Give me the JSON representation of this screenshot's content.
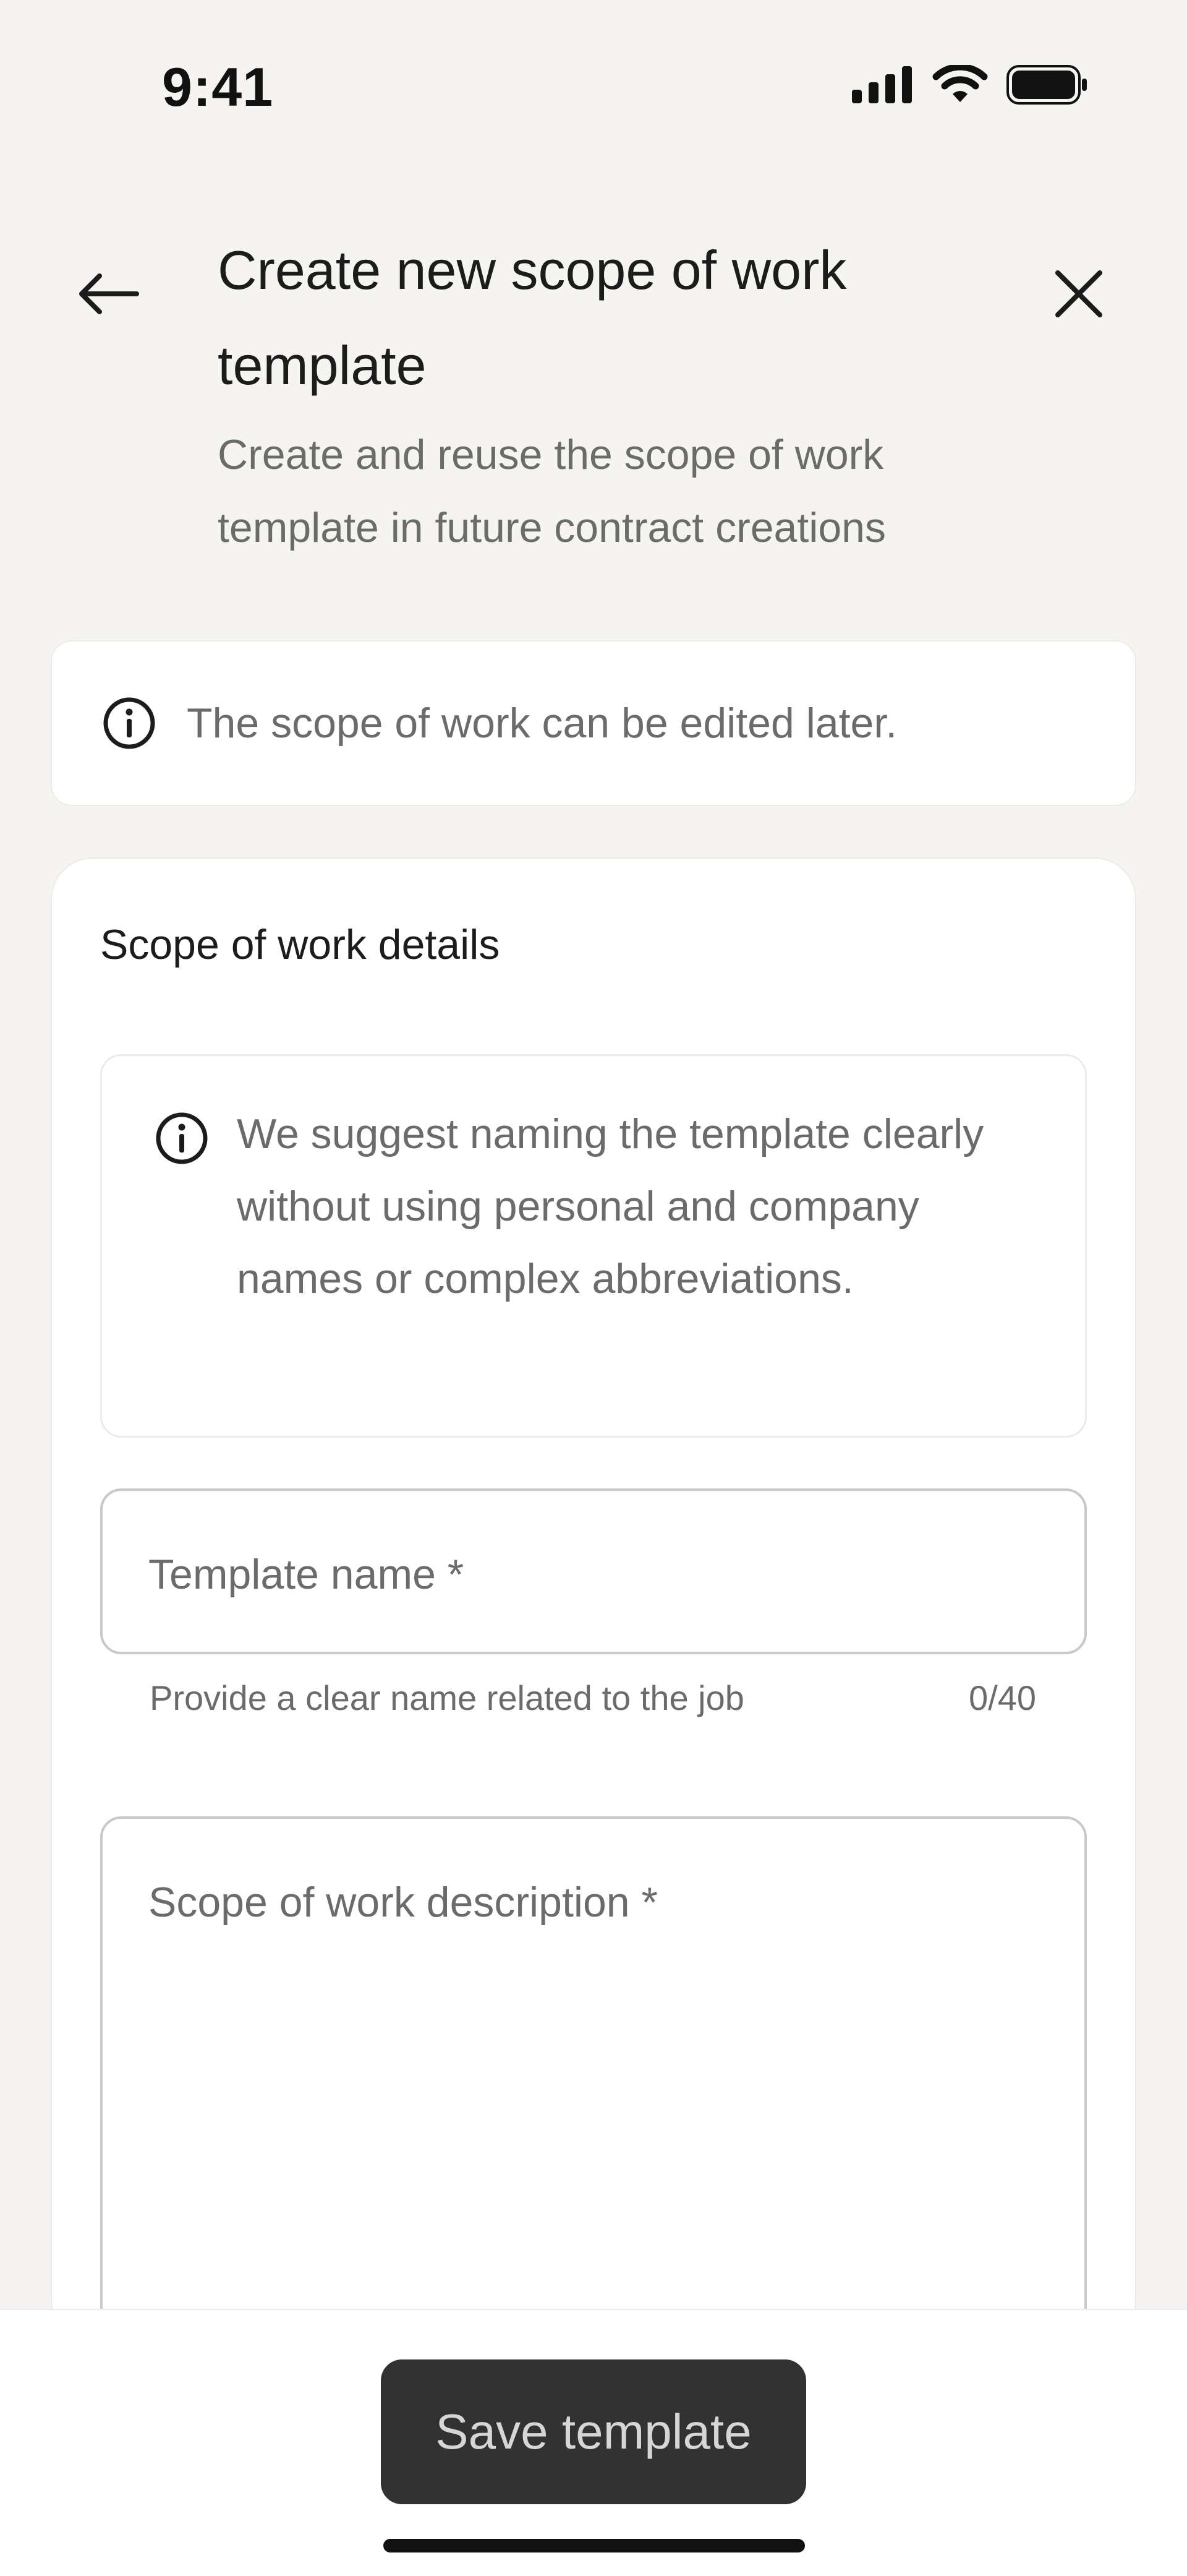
{
  "status_bar": {
    "time": "9:41",
    "icons": [
      "cellular-signal-icon",
      "wifi-icon",
      "battery-icon"
    ]
  },
  "header": {
    "back_icon": "arrow-left-icon",
    "close_icon": "close-icon",
    "title": "Create new scope of work template",
    "subtitle": "Create and reuse the scope of work template in future contract creations"
  },
  "info_banner": {
    "icon": "info-icon",
    "text": "The scope of work can be edited later."
  },
  "details": {
    "title": "Scope of work details",
    "suggestion": {
      "icon": "info-icon",
      "text": "We suggest naming the template clearly without using personal and company names or complex abbreviations."
    },
    "template_name": {
      "label": "Template name *",
      "value": "",
      "helper": "Provide a clear name related to the job",
      "counter": "0/40"
    },
    "description": {
      "label": "Scope of work description *",
      "value": ""
    }
  },
  "footer": {
    "save_label": "Save template"
  },
  "colors": {
    "background": "#f5f4f1",
    "surface": "#ffffff",
    "primary_button": "#323232",
    "primary_button_text": "#d6d6d6",
    "muted_text": "#6b6b6b",
    "border": "#c9c9c9"
  }
}
